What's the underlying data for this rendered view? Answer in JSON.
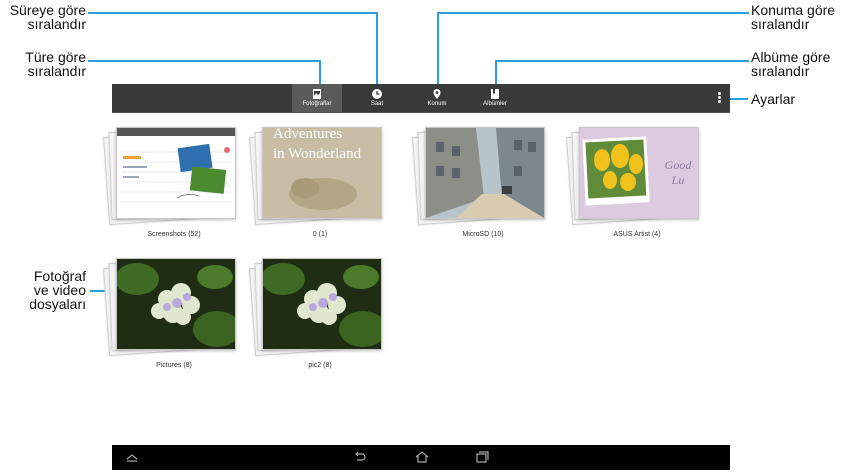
{
  "annotations": {
    "sort_by_time": [
      "Süreye göre",
      "sıralandır"
    ],
    "sort_by_type": [
      "Türe göre",
      "sıralandır"
    ],
    "sort_by_location": [
      "Konuma göre",
      "sıralandır"
    ],
    "sort_by_album": [
      "Albüme göre",
      "sıralandır"
    ],
    "settings": "Ayarlar",
    "files": [
      "Fotoğraf",
      "ve video",
      "dosyaları"
    ]
  },
  "actionbar": {
    "tabs": [
      {
        "label": "Fotoğraflar",
        "icon": "photos-icon",
        "selected": true
      },
      {
        "label": "Saat",
        "icon": "clock-icon",
        "selected": false
      },
      {
        "label": "Konum",
        "icon": "location-pin-icon",
        "selected": false
      },
      {
        "label": "Albümler",
        "icon": "album-icon",
        "selected": false
      }
    ],
    "overflow_icon": "overflow-menu-icon"
  },
  "albums": [
    {
      "caption": "Screenshots (52)",
      "thumb": "screenshot-doc"
    },
    {
      "caption": "0 (1)",
      "thumb": "wonderland",
      "thumb_text": [
        "Adventures",
        "in Wonderland"
      ]
    },
    {
      "caption": "MicroSD (10)",
      "thumb": "street"
    },
    {
      "caption": "ASUS Artist (4)",
      "thumb": "tulips",
      "thumb_text": [
        "Good Lu"
      ]
    },
    {
      "caption": "Pictures (8)",
      "thumb": "hydrangea"
    },
    {
      "caption": "pic2 (8)",
      "thumb": "hydrangea"
    }
  ],
  "navbar": {
    "icons": [
      "hide-keyboard-icon",
      "back-icon",
      "home-icon",
      "recent-apps-icon"
    ]
  },
  "colors": {
    "accent": "#29a0dd",
    "actionbar": "#3a3a3a",
    "navbar": "#000000"
  }
}
